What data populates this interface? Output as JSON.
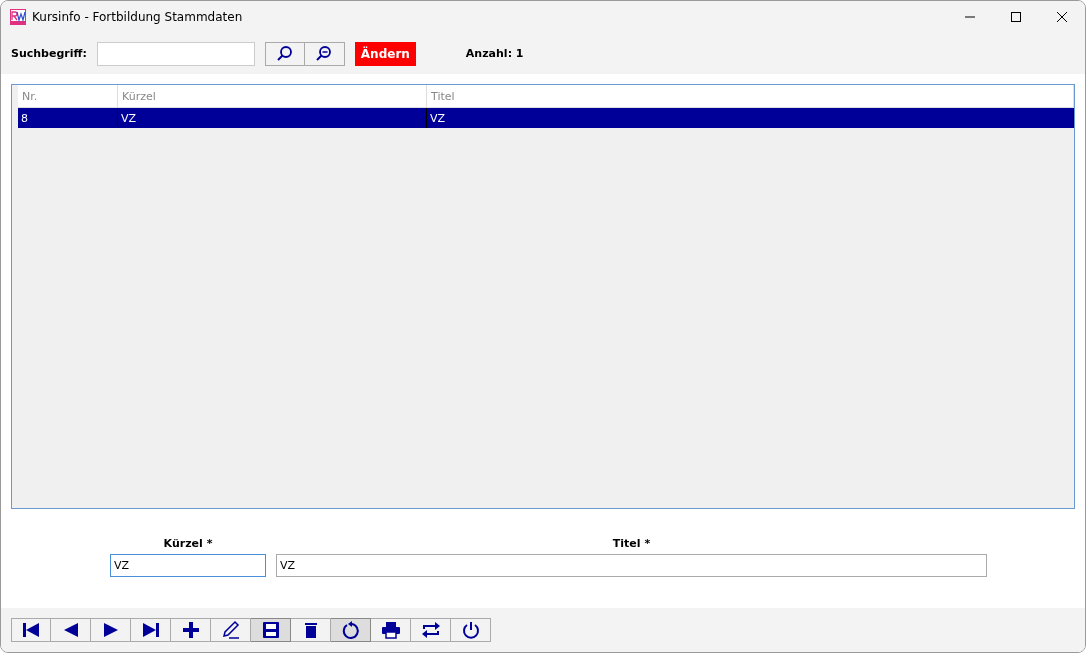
{
  "window": {
    "title": "Kursinfo - Fortbildung Stammdaten"
  },
  "search": {
    "label": "Suchbegriff:",
    "action": "Ändern",
    "count": "Anzahl: 1"
  },
  "table": {
    "columns": [
      "Nr.",
      "Kürzel",
      "Titel"
    ],
    "rows": [
      {
        "cells": [
          "8",
          "VZ",
          "VZ"
        ],
        "selected": true
      }
    ]
  },
  "form": {
    "fields": [
      {
        "label": "Kürzel *",
        "value": "VZ",
        "focused": true
      },
      {
        "label": "Titel *",
        "value": "VZ",
        "focused": false
      }
    ]
  },
  "toolbar": [
    {
      "kind": "first",
      "pressed": false
    },
    {
      "kind": "prev",
      "pressed": false
    },
    {
      "kind": "next",
      "pressed": false
    },
    {
      "kind": "last",
      "pressed": false
    },
    {
      "kind": "add",
      "pressed": false
    },
    {
      "kind": "edit",
      "pressed": false
    },
    {
      "kind": "save",
      "pressed": true
    },
    {
      "kind": "delete",
      "pressed": false
    },
    {
      "kind": "undo",
      "pressed": true
    },
    {
      "kind": "print",
      "pressed": false
    },
    {
      "kind": "swap",
      "pressed": false
    },
    {
      "kind": "power",
      "pressed": false
    }
  ]
}
